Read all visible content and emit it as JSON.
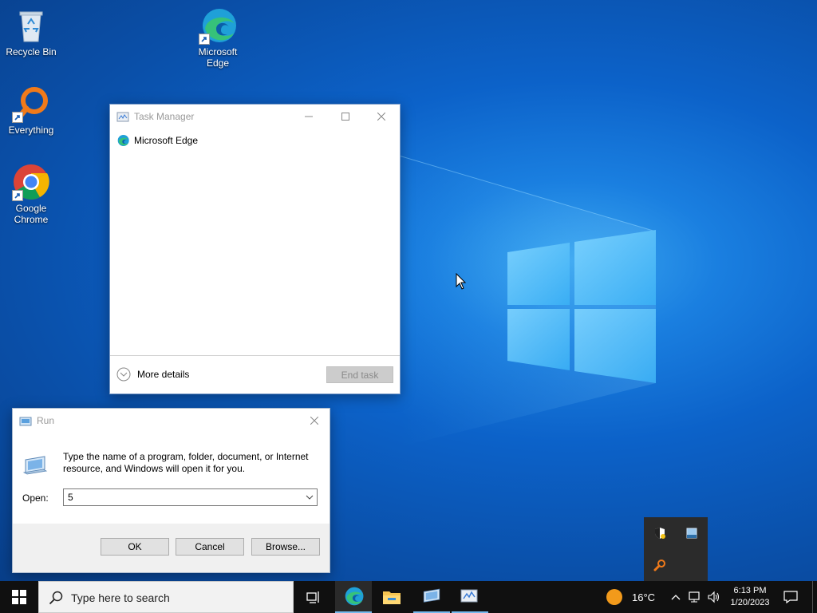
{
  "desktop": {
    "icons": [
      {
        "label": "Recycle Bin",
        "icon": "recycle-bin-icon"
      },
      {
        "label": "Microsoft Edge",
        "icon": "edge-icon"
      },
      {
        "label": "Everything",
        "icon": "everything-icon"
      },
      {
        "label": "Google Chrome",
        "icon": "chrome-icon"
      }
    ]
  },
  "task_manager": {
    "title": "Task Manager",
    "apps": [
      {
        "name": "Microsoft Edge",
        "icon": "edge-icon"
      }
    ],
    "more_details": "More details",
    "end_task": "End task"
  },
  "run_dialog": {
    "title": "Run",
    "description_line1": "Type the name of a program, folder, document, or Internet",
    "description_line2": "resource, and Windows will open it for you.",
    "open_label": "Open:",
    "open_value": "5",
    "ok": "OK",
    "cancel": "Cancel",
    "browse": "Browse..."
  },
  "taskbar": {
    "search_placeholder": "Type here to search",
    "weather": "16°C",
    "time": "6:13 PM",
    "date": "1/20/2023"
  },
  "colors": {
    "desktop_blue": "#0c62c9",
    "taskbar": "#101010",
    "accent": "#0078d7"
  }
}
